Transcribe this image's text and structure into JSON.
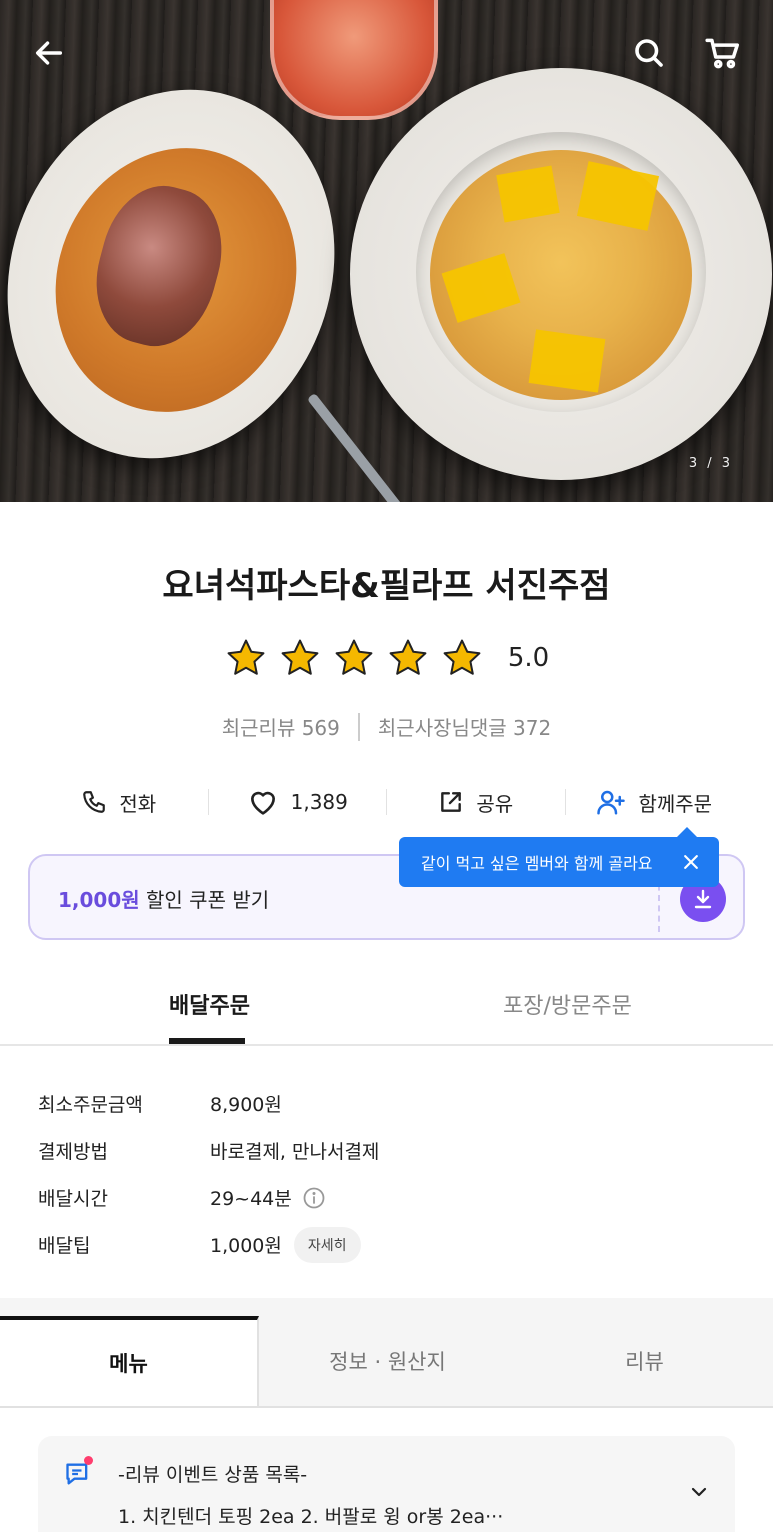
{
  "hero": {
    "image_counter": "3 / 3"
  },
  "store": {
    "name": "요녀석파스타&필라프 서진주점",
    "rating_value": 5.0,
    "rating_text": "5.0",
    "recent_reviews": "최근리뷰 569",
    "recent_owner_replies": "최근사장님댓글 372"
  },
  "actions": {
    "call": "전화",
    "favorites": "1,389",
    "share": "공유",
    "group_order": "함께주문"
  },
  "tooltip": {
    "text": "같이 먹고 싶은 멤버와 함께 골라요"
  },
  "coupon": {
    "amount": "1,000원",
    "label": " 할인 쿠폰 받기"
  },
  "order_tabs": {
    "delivery": "배달주문",
    "pickup": "포장/방문주문"
  },
  "info": {
    "rows": [
      {
        "label": "최소주문금액",
        "value": "8,900원"
      },
      {
        "label": "결제방법",
        "value": "바로결제, 만나서결제"
      },
      {
        "label": "배달시간",
        "value": "29~44분"
      },
      {
        "label": "배달팁",
        "value": "1,000원",
        "chip": "자세히"
      }
    ]
  },
  "menu_tabs": {
    "menu": "메뉴",
    "info": "정보 · 원산지",
    "review": "리뷰"
  },
  "notice": {
    "title": "-리뷰 이벤트 상품 목록-",
    "body": "1. 치킨텐더 토핑 2ea  2. 버팔로 윙 or봉 2ea···"
  },
  "colors": {
    "accent_purple": "#7a4ff0",
    "tooltip_blue": "#1f7bf2",
    "star": "#f5b800"
  }
}
